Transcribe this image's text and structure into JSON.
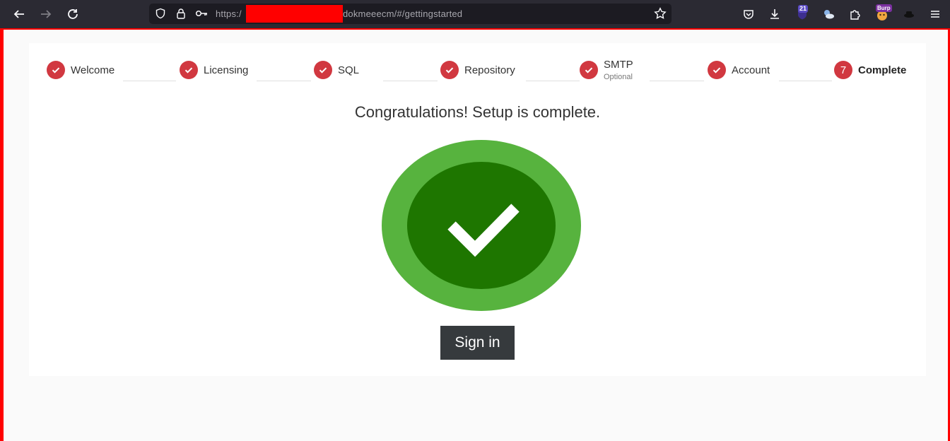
{
  "browser": {
    "url_prefix": "https:/",
    "url_suffix": "dokmeeecm/#/gettingstarted",
    "extension_badge_count": "21",
    "burp_badge": "Burp",
    "icons": [
      "back-arrow-icon",
      "forward-arrow-icon",
      "reload-icon",
      "shield-icon",
      "lock-icon",
      "key-icon",
      "star-icon",
      "pocket-icon",
      "download-icon",
      "extension-icon",
      "weather-icon",
      "puzzle-icon",
      "burp-icon",
      "profile-icon",
      "menu-icon"
    ]
  },
  "wizard": {
    "steps": [
      {
        "label": "Welcome",
        "status": "done"
      },
      {
        "label": "Licensing",
        "status": "done"
      },
      {
        "label": "SQL",
        "status": "done"
      },
      {
        "label": "Repository",
        "status": "done"
      },
      {
        "label": "SMTP",
        "sublabel": "Optional",
        "status": "done"
      },
      {
        "label": "Account",
        "status": "done"
      },
      {
        "label": "Complete",
        "number": "7",
        "status": "current"
      }
    ]
  },
  "main": {
    "heading": "Congratulations! Setup is complete.",
    "sign_in_label": "Sign in"
  },
  "colors": {
    "step_red": "#d13840",
    "outer_green": "#57b33e",
    "inner_green": "#1e7600",
    "button_dark": "#363a3d"
  }
}
